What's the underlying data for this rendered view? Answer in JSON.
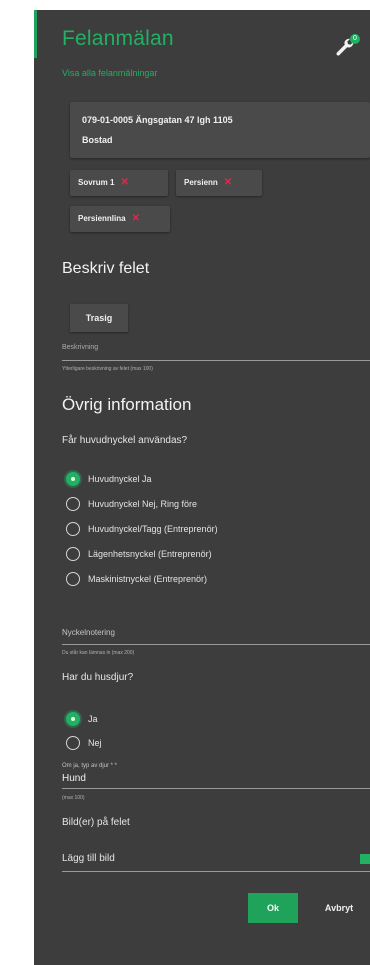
{
  "header": {
    "title": "Felanmälan",
    "subtitle": "Visa alla felanmälningar",
    "badge_count": "0"
  },
  "object": {
    "address": "079-01-0005 Ängsgatan 47 lgh 1105",
    "type": "Bostad",
    "remove": "✕"
  },
  "rooms": [
    {
      "label": "Sovrum 1",
      "remove": "✕"
    },
    {
      "label": "Persienn",
      "remove": "✕"
    },
    {
      "label": "Persiennlina",
      "remove": "✕"
    }
  ],
  "describe": {
    "heading": "Beskriv felet",
    "fault_button": "Trasig",
    "field_label": "Beskrivning",
    "field_hint": "Ytterligare beskrivning av felet (max 100)"
  },
  "other": {
    "heading": "Övrig information",
    "key_question": "Får huvudnyckel användas?",
    "key_options": [
      {
        "label": "Huvudnyckel Ja",
        "selected": true
      },
      {
        "label": "Huvudnyckel Nej, Ring före",
        "selected": false
      },
      {
        "label": "Huvudnyckel/Tagg (Entreprenör)",
        "selected": false
      },
      {
        "label": "Lägenhetsnyckel (Entreprenör)",
        "selected": false
      },
      {
        "label": "Maskinistnyckel (Entreprenör)",
        "selected": false
      }
    ],
    "key_note_label": "Nyckelnotering",
    "key_note_hint": "Du står kan lämnas in (max 200)",
    "pets_question": "Har du husdjur?",
    "pets_options": [
      {
        "label": "Ja",
        "selected": true
      },
      {
        "label": "Nej",
        "selected": false
      }
    ],
    "pet_type_label": "Om ja, typ av djur * *",
    "pet_type_value": "Hund",
    "pet_type_hint": "(max 100)",
    "images_label": "Bild(er) på felet",
    "add_image": "Lägg till bild"
  },
  "actions": {
    "ok": "Ok",
    "cancel": "Avbryt"
  },
  "colors": {
    "accent": "#22b063",
    "background": "#3d3d3d",
    "remove": "#e0284d"
  }
}
